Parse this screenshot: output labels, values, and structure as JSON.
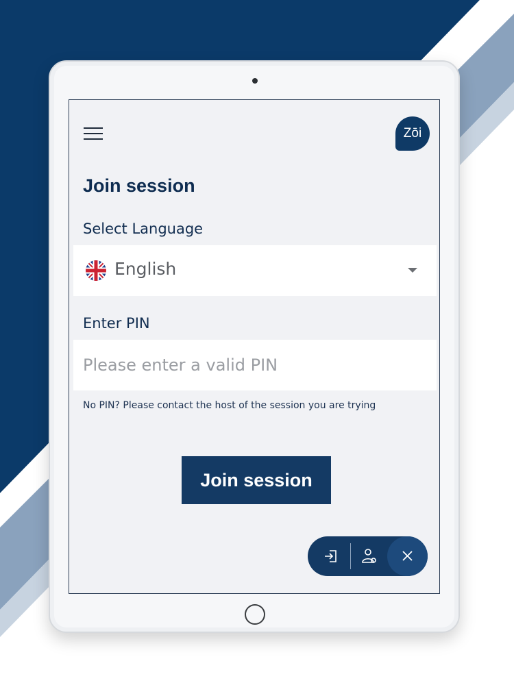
{
  "header": {
    "logo_text": "Zōi"
  },
  "page": {
    "title": "Join session"
  },
  "language": {
    "label": "Select Language",
    "selected": "English",
    "flag_icon": "uk-flag-icon"
  },
  "pin": {
    "label": "Enter PIN",
    "value": "",
    "placeholder": "Please enter a valid PIN"
  },
  "hint": "No PIN? Please contact the host of the session you are trying",
  "actions": {
    "join_label": "Join session"
  },
  "fab": {
    "icons": [
      "enter-session-icon",
      "doctor-icon",
      "close-icon"
    ]
  },
  "colors": {
    "brand_navy": "#0f3a66",
    "button_navy": "#143a64",
    "background_stripe_light": "#9fb3c9"
  }
}
